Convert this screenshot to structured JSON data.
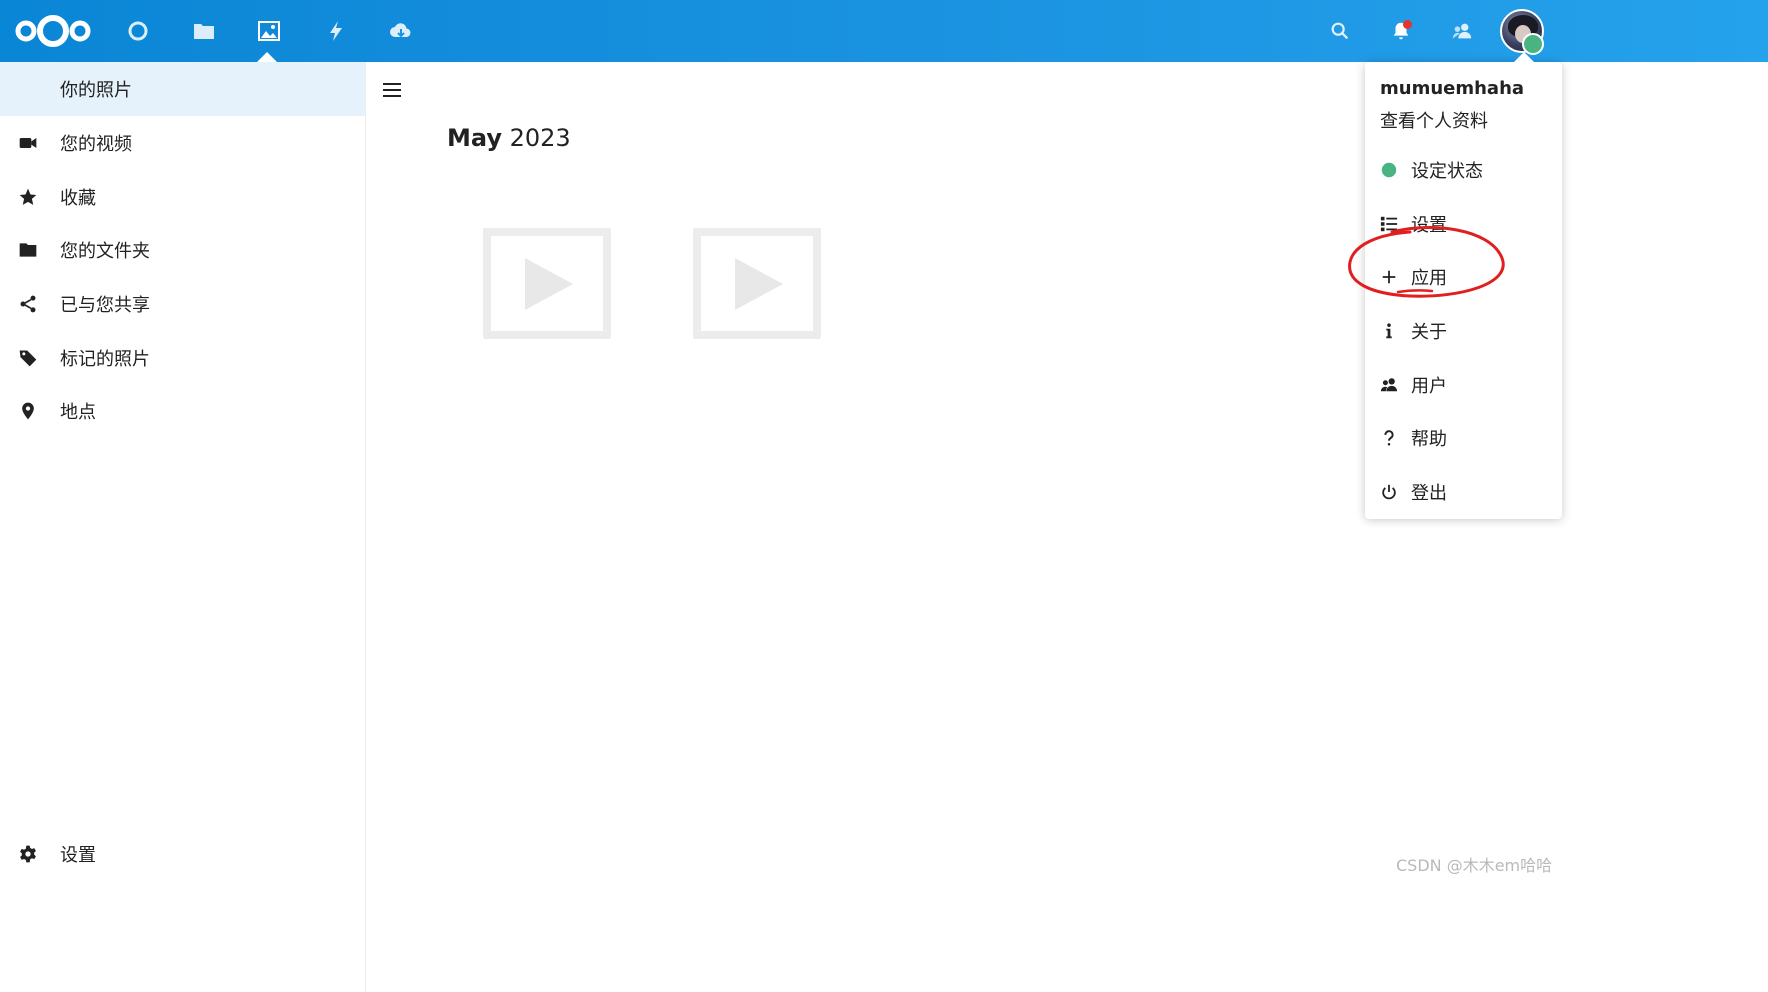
{
  "header": {
    "apps": [
      {
        "name": "dashboard",
        "icon": "circle-icon"
      },
      {
        "name": "files",
        "icon": "folder-icon"
      },
      {
        "name": "photos",
        "icon": "image-icon",
        "active": true
      },
      {
        "name": "activity",
        "icon": "lightning-icon"
      },
      {
        "name": "cloud",
        "icon": "cloud-download-icon"
      }
    ],
    "right_icons": [
      "search-icon",
      "bell-icon",
      "contacts-icon"
    ],
    "colors": {
      "bar": "#1b93e0",
      "notification": "#e9322d",
      "status_online": "#49b382"
    }
  },
  "nav": {
    "items": [
      {
        "label": "你的照片",
        "icon": "none",
        "active": true
      },
      {
        "label": "您的视频",
        "icon": "video-camera-icon"
      },
      {
        "label": "收藏",
        "icon": "star-icon"
      },
      {
        "label": "您的文件夹",
        "icon": "folder-icon"
      },
      {
        "label": "已与您共享",
        "icon": "share-icon"
      },
      {
        "label": "标记的照片",
        "icon": "tag-icon"
      },
      {
        "label": "地点",
        "icon": "location-pin-icon"
      }
    ],
    "settings_label": "设置"
  },
  "main": {
    "month_bold": "May",
    "month_year": "2023",
    "thumbnails": 2
  },
  "user_menu": {
    "username": "mumuemhaha",
    "profile_label": "查看个人资料",
    "items": [
      {
        "label": "设定状态",
        "icon": "status-dot-icon"
      },
      {
        "label": "设置",
        "icon": "settings-list-icon"
      },
      {
        "label": "应用",
        "icon": "plus-icon"
      },
      {
        "label": "关于",
        "icon": "info-icon"
      },
      {
        "label": "用户",
        "icon": "users-icon"
      },
      {
        "label": "帮助",
        "icon": "question-icon"
      },
      {
        "label": "登出",
        "icon": "power-icon"
      }
    ]
  },
  "watermark": "CSDN @木木em哈哈"
}
